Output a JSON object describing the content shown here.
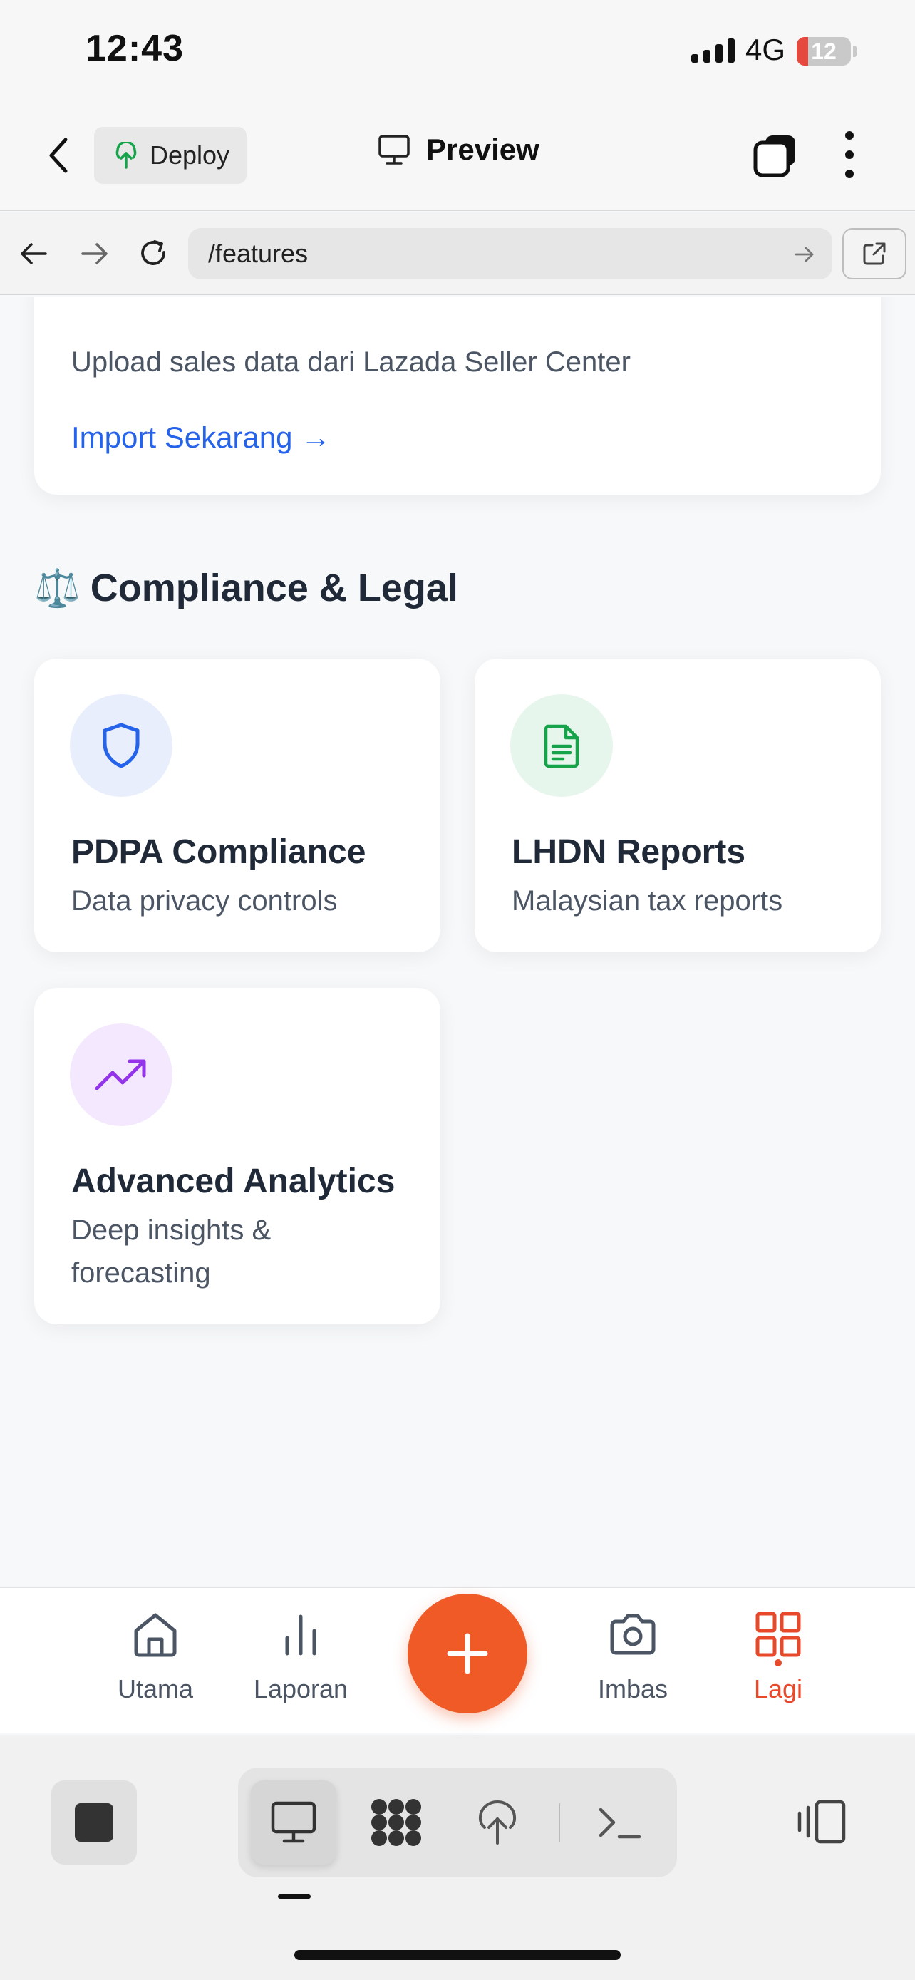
{
  "status": {
    "time": "12:43",
    "network": "4G",
    "battery": "12",
    "battery_color": "#e5483d"
  },
  "header": {
    "deploy_label": "Deploy",
    "preview_label": "Preview"
  },
  "urlbar": {
    "url": "/features"
  },
  "import_card": {
    "description": "Upload sales data dari Lazada Seller Center",
    "link": "Import Sekarang →"
  },
  "section": {
    "emoji": "⚖️",
    "title": "Compliance & Legal"
  },
  "features": [
    {
      "title": "PDPA Compliance",
      "desc": "Data privacy controls",
      "icon": "shield-icon",
      "bg": "#e8eefc",
      "color": "#2563eb"
    },
    {
      "title": "LHDN Reports",
      "desc": "Malaysian tax reports",
      "icon": "document-icon",
      "bg": "#e6f6ec",
      "color": "#16a34a"
    },
    {
      "title": "Advanced Analytics",
      "desc": "Deep insights & forecasting",
      "icon": "trending-up-icon",
      "bg": "#f3e8fd",
      "color": "#9333ea"
    }
  ],
  "tabbar": {
    "items": [
      {
        "label": "Utama",
        "icon": "home-icon"
      },
      {
        "label": "Laporan",
        "icon": "bar-chart-icon"
      },
      {
        "label": "Imbas",
        "icon": "camera-icon"
      },
      {
        "label": "Lagi",
        "icon": "grid-icon"
      }
    ],
    "active": "Lagi",
    "accent": "#f05a27"
  }
}
